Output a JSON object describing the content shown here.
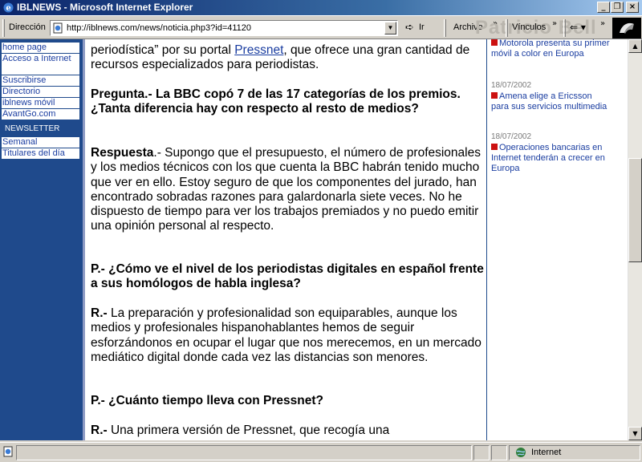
{
  "window": {
    "title": "IBLNEWS - Microsoft Internet Explorer",
    "minimize": "_",
    "maximize": "❐",
    "close": "×"
  },
  "toolbar": {
    "address_label": "Dirección",
    "url": "http://iblnews.com/news/noticia.php3?id=41120",
    "go_label": "Ir",
    "archivo_label": "Archivo",
    "vinculos_label": "Vínculos",
    "watermark": "Patricio Bell"
  },
  "leftnav": {
    "items": [
      {
        "label": "home page"
      },
      {
        "label": "Acceso a Internet"
      },
      {
        "label": "Suscribirse"
      },
      {
        "label": "Directorio"
      },
      {
        "label": "iblnews móvil"
      },
      {
        "label": "AvantGo.com"
      }
    ],
    "section": "NEWSLETTER",
    "newsletter_items": [
      {
        "label": "Semanal"
      },
      {
        "label": "Titulares del día"
      }
    ]
  },
  "article": {
    "p1_prefix": "periodística” por su portal ",
    "p1_link": "Pressnet",
    "p1_suffix": ", que ofrece una gran cantidad de recursos especializados para periodistas.",
    "q1": "Pregunta.- La BBC copó 7 de las 17 categorías de los premios. ¿Tanta diferencia hay con respecto al resto de medios?",
    "a1_label": "Respuesta",
    "a1_text": ".- Supongo que el presupuesto, el número de profesionales y los medios técnicos con los que cuenta la BBC habrán tenido mucho que ver en ello. Estoy seguro de que los componentes del jurado, han encontrado sobradas razones para galardonarla siete veces. No he dispuesto de tiempo para ver los trabajos premiados y no puedo emitir una opinión personal al respecto.",
    "q2": "P.- ¿Cómo ve el nivel de los periodistas digitales en español frente a sus homólogos de habla inglesa?",
    "a2_label": "R.-",
    "a2_text": " La preparación y profesionalidad son equiparables, aunque los medios y profesionales hispanohablantes hemos de seguir esforzándonos en ocupar el lugar que nos merecemos, en un mercado mediático digital donde cada vez las distancias son menores.",
    "q3": "P.- ¿Cuánto tiempo lleva con Pressnet?",
    "a3_label": "R.-",
    "a3_text": " Una primera versión de Pressnet, que recogía una"
  },
  "rightcol": {
    "news": [
      {
        "date": "",
        "title": "Motorola presenta su primer móvil a color en Europa"
      },
      {
        "date": "18/07/2002",
        "title": "Amena elige a Ericsson para sus servicios multimedia"
      },
      {
        "date": "18/07/2002",
        "title": "Operaciones bancarias en Internet tenderán a crecer en Europa"
      }
    ]
  },
  "statusbar": {
    "zone": "Internet"
  },
  "colors": {
    "nav_blue": "#1f4a8c",
    "link": "#1a3da0",
    "bullet": "#cc1111"
  }
}
